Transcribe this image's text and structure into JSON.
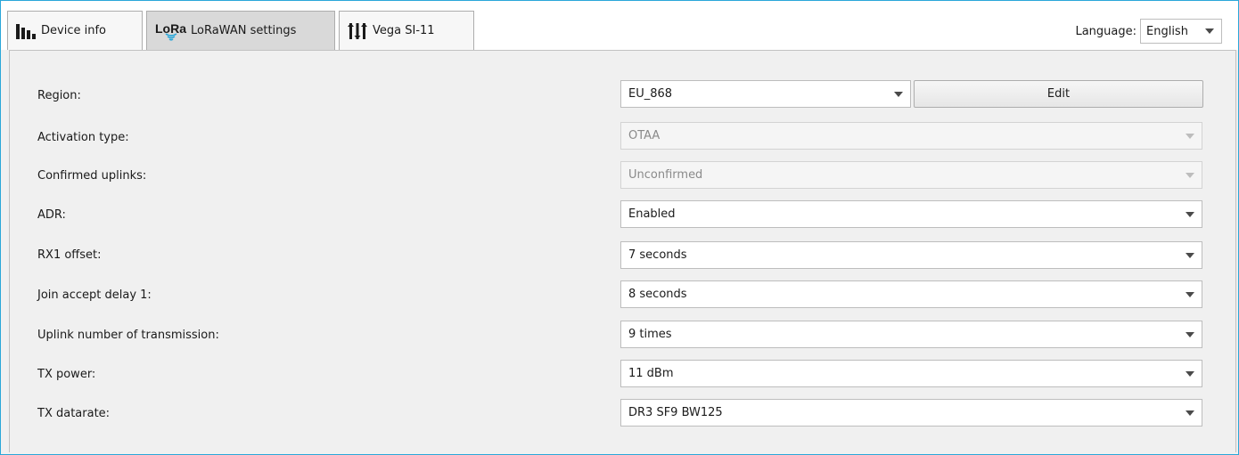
{
  "tabs": [
    {
      "label": "Device info",
      "icon": "bar-chart-icon"
    },
    {
      "label": "LoRaWAN settings",
      "icon": "lora-icon",
      "logo_text": "LoRa"
    },
    {
      "label": "Vega SI-11",
      "icon": "sliders-icon"
    }
  ],
  "language": {
    "label": "Language:",
    "value": "English"
  },
  "region": {
    "label": "Region:",
    "value": "EU_868",
    "edit_label": "Edit"
  },
  "settings": {
    "activation_type": {
      "label": "Activation type:",
      "value": "OTAA"
    },
    "confirmed_uplinks": {
      "label": "Confirmed uplinks:",
      "value": "Unconfirmed"
    },
    "adr": {
      "label": "ADR:",
      "value": "Enabled"
    },
    "rx1_offset": {
      "label": "RX1 offset:",
      "value": "7 seconds"
    },
    "join_accept_delay_1": {
      "label": "Join accept delay 1:",
      "value": "8 seconds"
    },
    "uplink_transmissions": {
      "label": "Uplink number of transmission:",
      "value": "9 times"
    },
    "tx_power": {
      "label": "TX power:",
      "value": "11 dBm"
    },
    "tx_datarate": {
      "label": "TX datarate:",
      "value": "DR3 SF9 BW125"
    }
  },
  "colors": {
    "window_border": "#2aa7d9",
    "lora_wave": "#2aa7d9",
    "active_tab": "#d9d9d9"
  }
}
